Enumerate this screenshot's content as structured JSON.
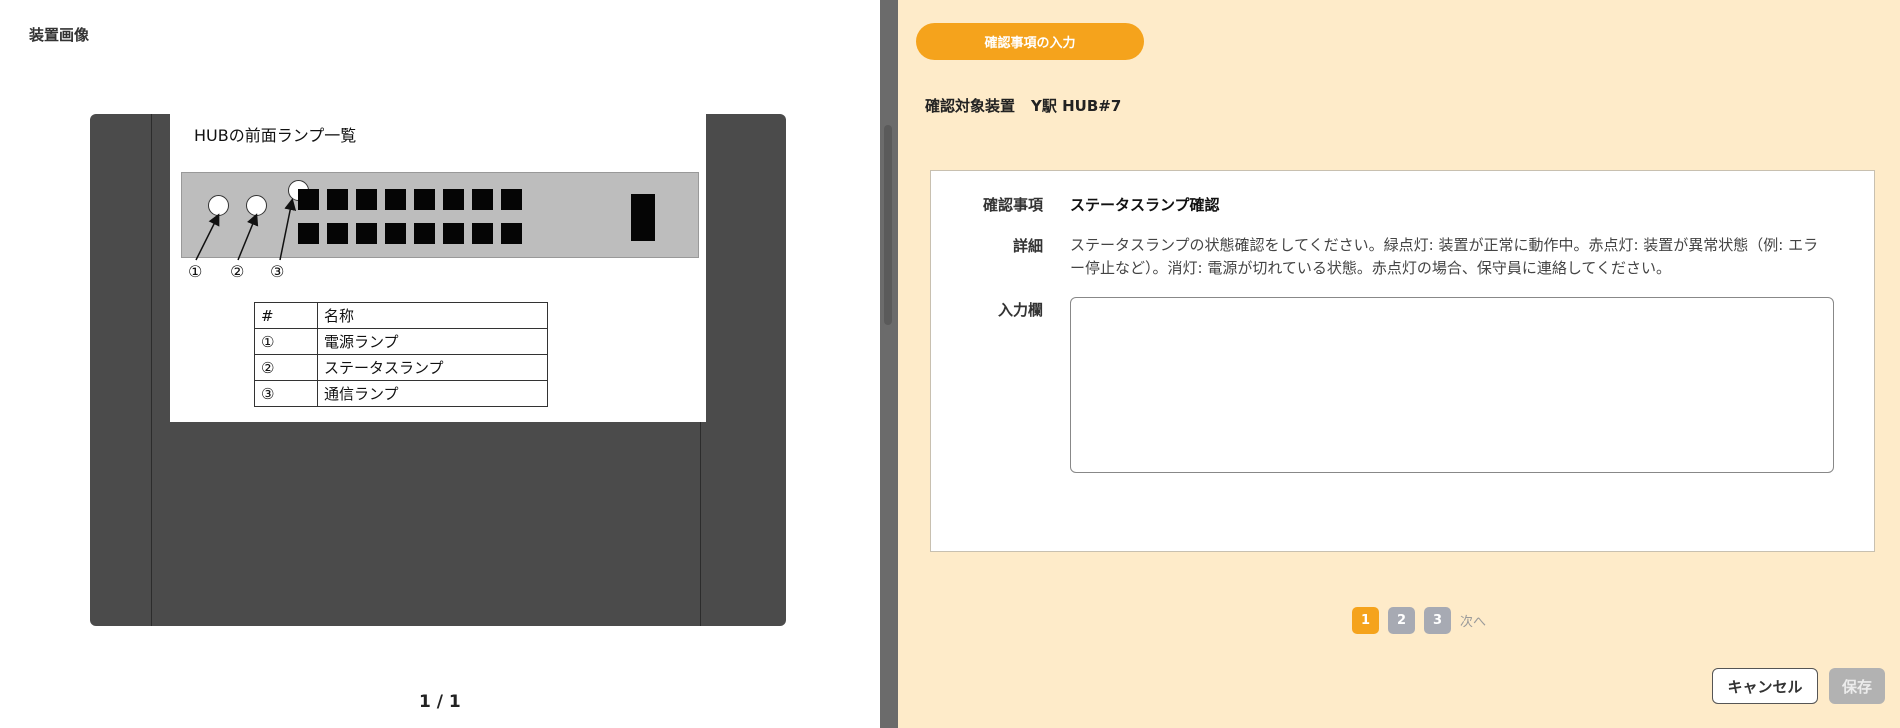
{
  "left": {
    "title": "装置画像",
    "doc": {
      "title": "HUBの前面ランプ一覧",
      "callouts": [
        "①",
        "②",
        "③"
      ],
      "table": {
        "headers": [
          "#",
          "名称"
        ],
        "rows": [
          [
            "①",
            "電源ランプ"
          ],
          [
            "②",
            "ステータスランプ"
          ],
          [
            "③",
            "通信ランプ"
          ]
        ]
      }
    },
    "pager": "1 / 1"
  },
  "right": {
    "step_label": "確認事項の入力",
    "target_label": "確認対象装置",
    "target_value": "Y駅 HUB#7",
    "item_label": "確認事項",
    "item_value": "ステータスランプ確認",
    "detail_label": "詳細",
    "detail_value": "ステータスランプの状態確認をしてください。緑点灯: 装置が正常に動作中。赤点灯: 装置が異常状態（例: エラー停止など）。消灯: 電源が切れている状態。赤点灯の場合、保守員に連絡してください。",
    "input_label": "入力欄",
    "input_value": "",
    "pages": [
      "1",
      "2",
      "3"
    ],
    "current_page": "1",
    "next_label": "次へ",
    "cancel_label": "キャンセル",
    "save_label": "保存"
  },
  "colors": {
    "accent": "#f5a31c",
    "panel_bg": "#feebc9",
    "page_inactive": "#a7aab3",
    "device_body": "#4b4b4b"
  }
}
